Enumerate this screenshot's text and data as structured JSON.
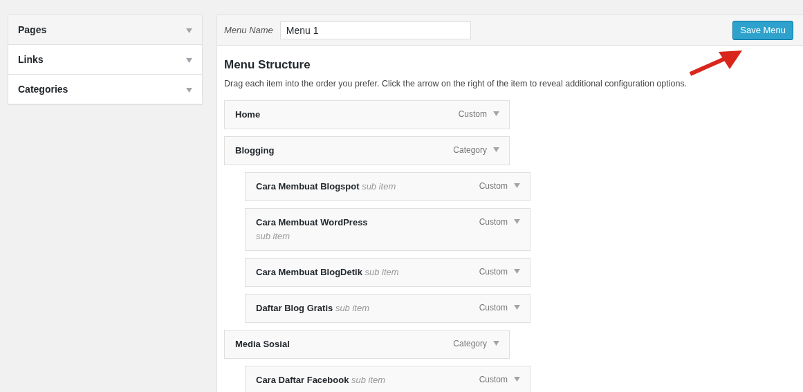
{
  "sidebar": {
    "items": [
      {
        "label": "Pages"
      },
      {
        "label": "Links"
      },
      {
        "label": "Categories"
      }
    ]
  },
  "menu_header": {
    "label": "Menu Name",
    "value": "Menu 1",
    "save_button": "Save Menu"
  },
  "menu_structure": {
    "title": "Menu Structure",
    "description": "Drag each item into the order you prefer. Click the arrow on the right of the item to reveal additional configuration options.",
    "items": [
      {
        "title": "Home",
        "type": "Custom"
      },
      {
        "title": "Blogging",
        "type": "Category",
        "children": [
          {
            "title": "Cara Membuat Blogspot",
            "note": "sub item",
            "type": "Custom"
          },
          {
            "title": "Cara Membuat WordPress",
            "note": "sub item",
            "type": "Custom"
          },
          {
            "title": "Cara Membuat BlogDetik",
            "note": "sub item",
            "type": "Custom"
          },
          {
            "title": "Daftar Blog Gratis",
            "note": "sub item",
            "type": "Custom"
          }
        ]
      },
      {
        "title": "Media Sosial",
        "type": "Category",
        "children": [
          {
            "title": "Cara Daftar Facebook",
            "note": "sub item",
            "type": "Custom"
          }
        ]
      }
    ]
  }
}
